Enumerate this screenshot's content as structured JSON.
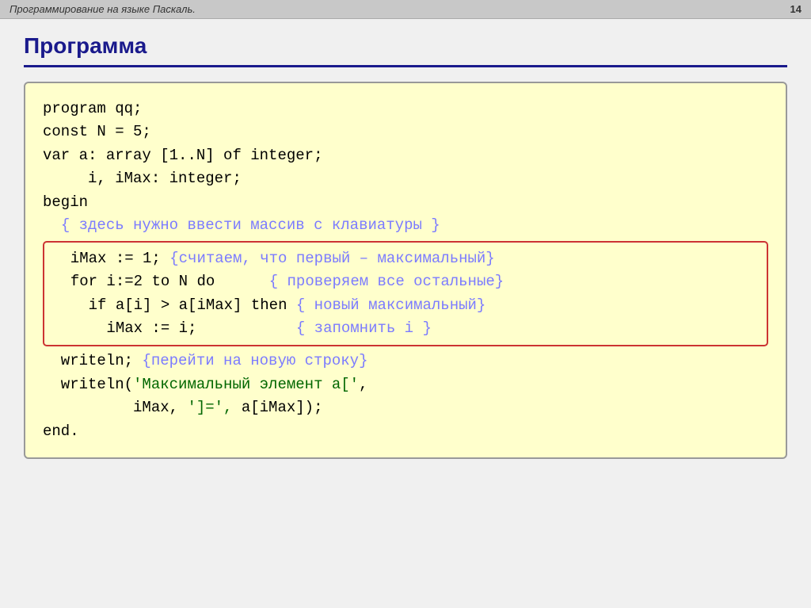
{
  "header": {
    "title": "Программирование на языке Паскаль.",
    "page": "14"
  },
  "slide": {
    "title": "Программа",
    "code_lines": [
      {
        "id": "line1",
        "text": "program qq;"
      },
      {
        "id": "line2",
        "text": "const N = 5;"
      },
      {
        "id": "line3",
        "text": "var a: array [1..N] of integer;"
      },
      {
        "id": "line4",
        "text": "     i, iMax: integer;"
      },
      {
        "id": "line5",
        "text": "begin"
      },
      {
        "id": "line6",
        "text": "  { здесь нужно ввести массив с клавиатуры }",
        "is_comment": true
      },
      {
        "id": "line7",
        "text": "  iMax := 1; {считаем, что первый – максимальный}",
        "highlighted": true
      },
      {
        "id": "line8",
        "text": "  for i:=2 to N do      { проверяем все остальные}",
        "highlighted": true
      },
      {
        "id": "line9",
        "text": "    if a[i] > a[iMax] then { новый максимальный}",
        "highlighted": true
      },
      {
        "id": "line10",
        "text": "      iMax := i;           { запомнить i }",
        "highlighted": true
      },
      {
        "id": "line11",
        "text": "  writeln; {перейти на новую строку}"
      },
      {
        "id": "line12",
        "text": "  writeln('Максимальный элемент a[',"
      },
      {
        "id": "line13",
        "text": "          iMax, ']=', a[iMax]);"
      },
      {
        "id": "line14",
        "text": "end."
      }
    ]
  }
}
